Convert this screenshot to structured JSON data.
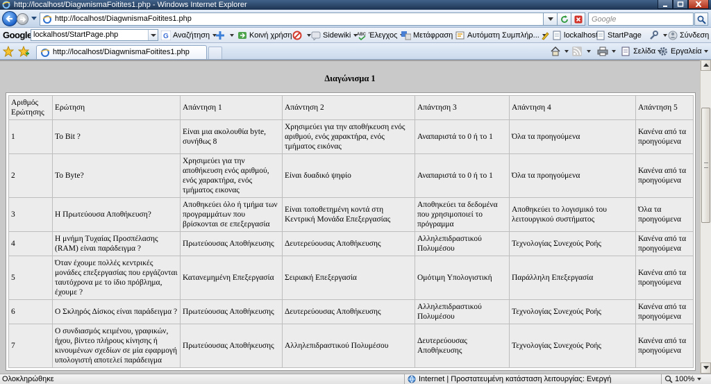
{
  "window": {
    "title": "http://localhost/DiagwnismaFoitites1.php - Windows Internet Explorer"
  },
  "navbar": {
    "url": "http://localhost/DiagwnismaFoitites1.php",
    "search_placeholder": "Google"
  },
  "google_toolbar": {
    "logo": "Google",
    "search_value": "lockalhost/StartPage.php",
    "items": [
      "Αναζήτηση",
      "Κοινή χρήση",
      "Sidewiki",
      "Έλεγχος",
      "Μετάφραση",
      "Αυτόματη Συμπλήρ...",
      "lockalhost",
      "StartPage",
      "Σύνδεση"
    ]
  },
  "tab": {
    "title": "http://localhost/DiagwnismaFoitites1.php"
  },
  "command_bar": {
    "page_label": "Σελίδα",
    "tools_label": "Εργαλεία"
  },
  "page": {
    "heading": "Διαγώνισμα 1",
    "table": {
      "headers": [
        "Αριθμός Ερώτησης",
        "Ερώτηση",
        "Απάντηση 1",
        "Απάντηση 2",
        "Απάντηση 3",
        "Απάντηση 4",
        "Απάντηση 5"
      ],
      "rows": [
        [
          "1",
          "Το Bit ?",
          "Είναι μια ακολουθία byte, συνήθως 8",
          "Χρησιμεύει για την αποθήκευση ενός αριθμού, ενός χαρακτήρα, ενός τμήματος εικόνας",
          "Αναπαριστά το 0 ή το 1",
          "Όλα τα προηγούμενα",
          "Κανένα από τα προηγούμενα"
        ],
        [
          "2",
          "Το Byte?",
          "Χρησιμεύει για την αποθήκευση ενός αριθμού, ενός χαρακτήρα, ενός τμήματος εικονας",
          "Είναι δυαδικό ψηφίο",
          "Αναπαριστά το 0 ή το 1",
          "Όλα τα προηγούμενα",
          "Κανένα από τα προηγούμενα"
        ],
        [
          "3",
          "Η Πρωτεύουσα Αποθήκευση?",
          "Αποθηκεύει όλο ή τμήμα των προγραμμάτων που βρίσκονται σε επεξεργασία",
          "Είναι τοποθετημένη κοντά στη Κεντρική Μονάδα Επεξεργασίας",
          "Αποθηκεύει τα δεδομένα που χρησιμοποιεί το πρόγραμμα",
          "Αποθηκεύει το λογισμικό του λειτουργικού συστήματος",
          "Όλα τα προηγούμενα"
        ],
        [
          "4",
          "Η μνήμη Τυχαίας Προσπέλασης (RAM) είναι παράδειγμα ?",
          "Πρωτεύουσας Αποθήκευσης",
          "Δευτερεύουσας Αποθήκευσης",
          "Αλληλεπιδραστικού Πολυμέσου",
          "Τεχνολογίας Συνεχούς Ροής",
          "Κανένα από τα προηγούμενα"
        ],
        [
          "5",
          "Όταν έχουμε πολλές κεντρικές μονάδες επεξεργασίας που εργάζονται ταυτόχρονα με το ίδιο πρόβλημα, έχουμε ?",
          "Κατανεμημένη Επεξεργασία",
          "Σειριακή Επεξεργασία",
          "Ομότιμη Υπολογιστική",
          "Παράλληλη Επεξεργασία",
          "Κανένα από τα προηγούμενα"
        ],
        [
          "6",
          "Ο Σκληρός Δίσκος είναι παράδειγμα ?",
          "Πρωτεύουσας Αποθήκευσης",
          "Δευτερεύουσας Αποθήκευσης",
          "Αλληλεπιδραστικού Πολυμέσου",
          "Τεχνολογίας Συνεχούς Ροής",
          "Κανένα από τα προηγούμενα"
        ],
        [
          "7",
          "Ο συνδιασμός κειμένου, γραφικών, ήχου, βίντεο πλήρους κίνησης ή κινουμένων σχεδίων σε μία εφαρμογή υπολογιστή αποτελεί παράδειγμα",
          "Πρωτεύουσας Αποθήκευσης",
          "Αλληλεπιδραστικού Πολυμέσου",
          "Δευτερεύουσας Αποθήκευσης",
          "Τεχνολογίας Συνεχούς Ροής",
          "Κανένα από τα προηγούμενα"
        ]
      ]
    }
  },
  "status": {
    "left": "Ολοκληρώθηκε",
    "zone": "Internet | Προστατευμένη κατάσταση λειτουργίας: Ενεργή",
    "zoom": "100%"
  }
}
